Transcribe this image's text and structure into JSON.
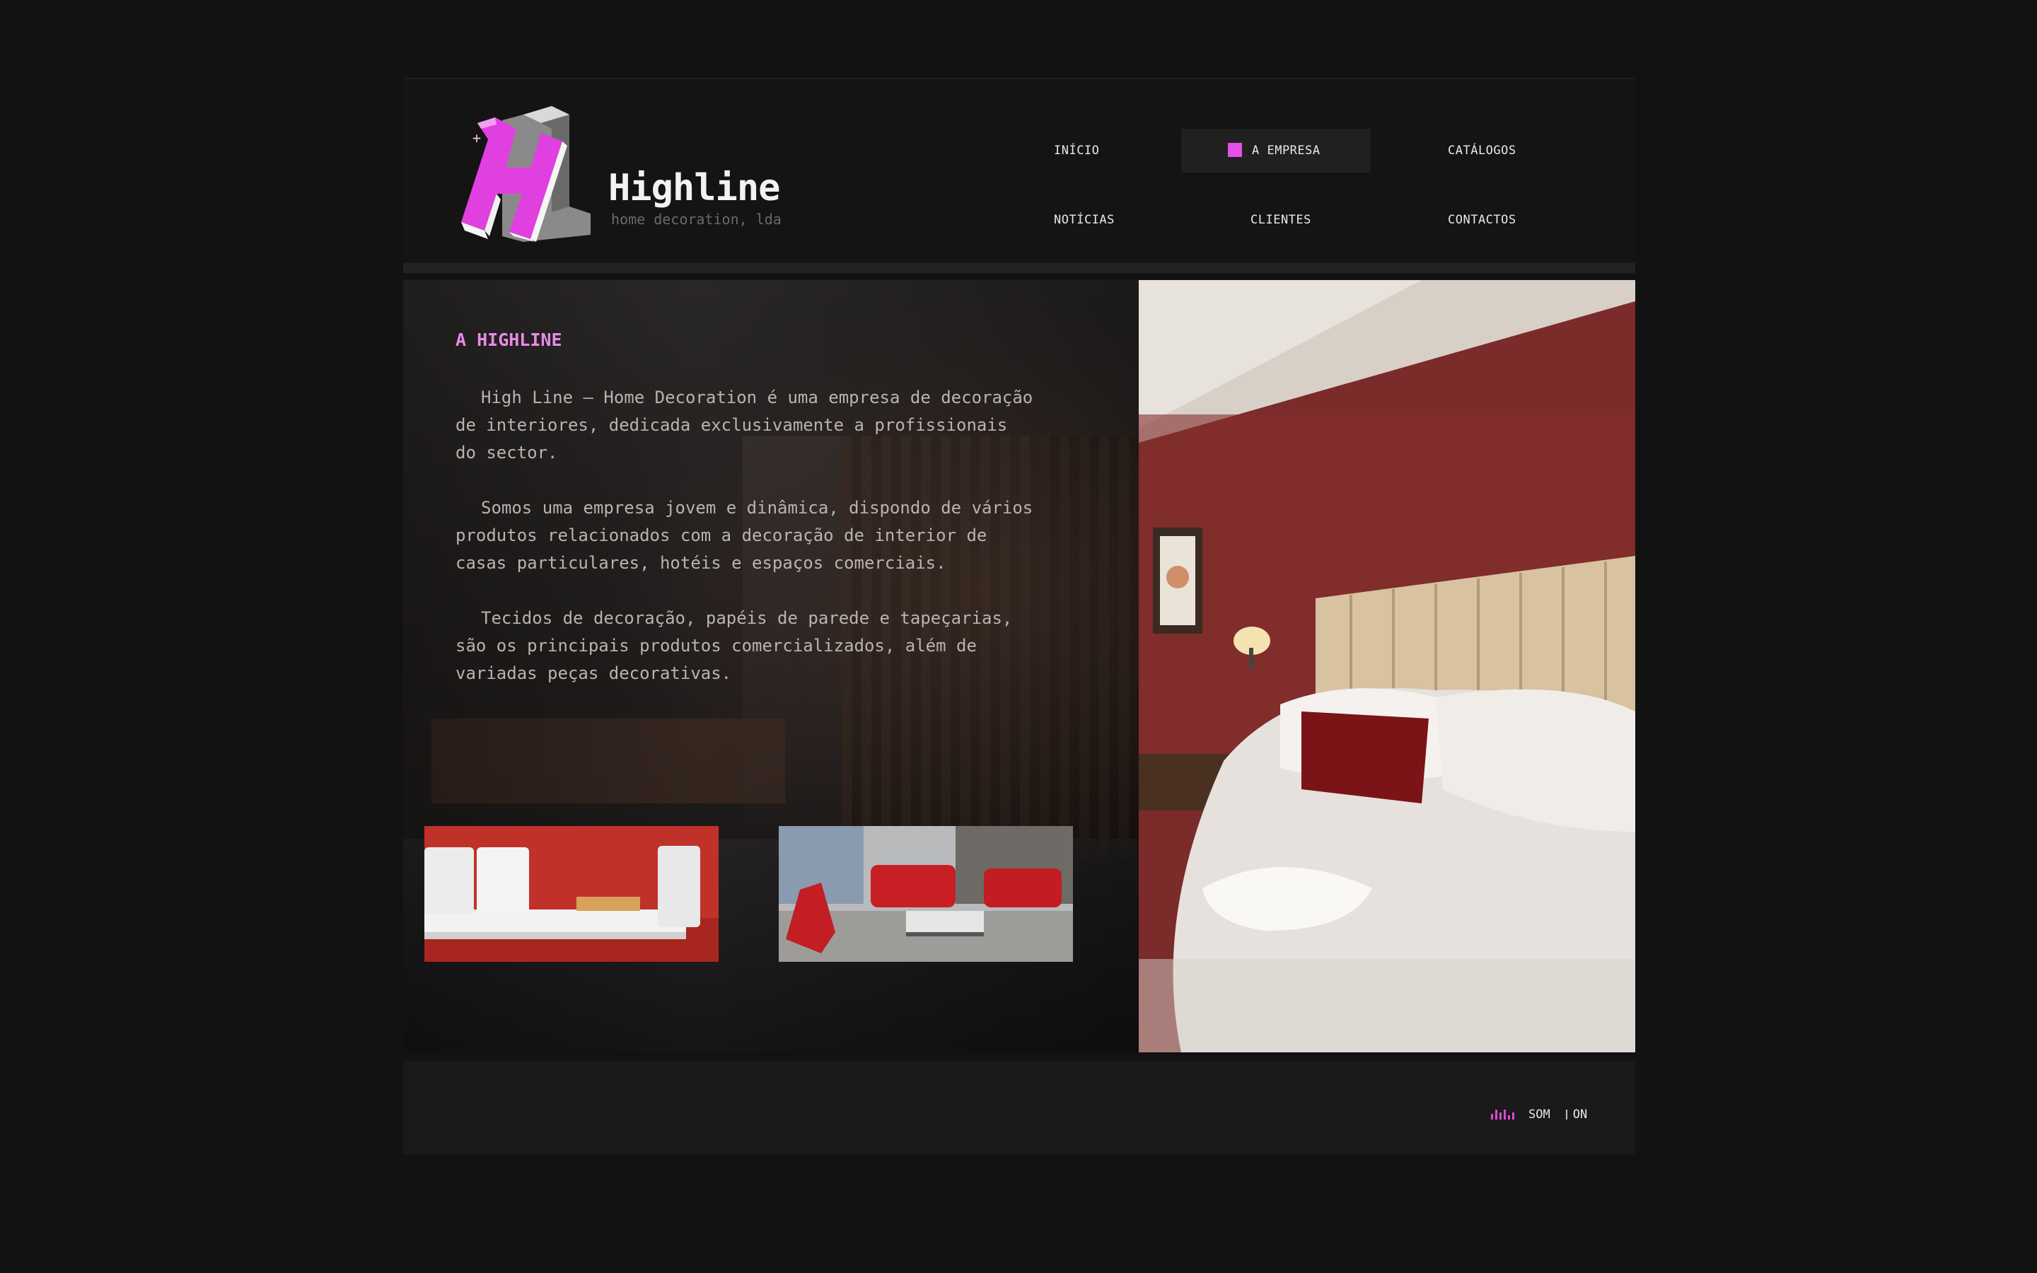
{
  "brand": {
    "name": "Highline",
    "subtitle": "home decoration, lda",
    "logo_icon": "hl-logo",
    "accent_color": "#e650e6"
  },
  "nav": {
    "items": [
      {
        "label": "Início",
        "active": false
      },
      {
        "label": "A Empresa",
        "active": true
      },
      {
        "label": "Catálogos",
        "active": false
      },
      {
        "label": "Notícias",
        "active": false
      },
      {
        "label": "Clientes",
        "active": false
      },
      {
        "label": "Contactos",
        "active": false
      }
    ]
  },
  "main": {
    "title": "A HIGHLINE",
    "paragraphs": [
      "High Line – Home Decoration é uma empresa de decoração de interiores, dedicada exclusivamente a profissionais do sector.",
      "Somos uma empresa jovem e dinâmica, dispondo de vários produtos relacionados com a decoração de interior de casas particulares, hotéis e espaços comerciais.",
      "Tecidos de decoração, papéis de parede e tapeçarias, são os principais produtos comercializados, além de variadas peças decorativas."
    ],
    "thumbnails": [
      {
        "name": "sofa-thumbnail"
      },
      {
        "name": "living-room-thumbnail"
      }
    ],
    "hero_image": "hotel-bedroom-photo"
  },
  "footer": {
    "sound_label": "SOM",
    "sound_state": "ON",
    "sound_icon": "equalizer-icon"
  }
}
